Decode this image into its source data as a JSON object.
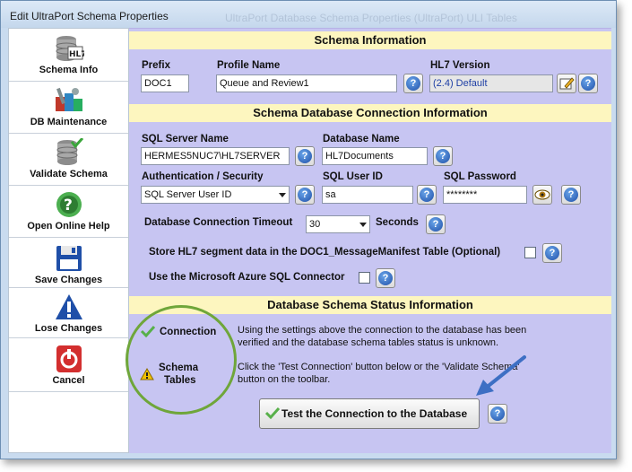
{
  "window": {
    "title": "Edit UltraPort Schema Properties",
    "ghost_title": "UltraPort Database Schema Properties (UltraPort) ULI Tables"
  },
  "toolbar": {
    "items": [
      {
        "label": "Schema Info",
        "icon": "database-hl7-icon"
      },
      {
        "label": "DB Maintenance",
        "icon": "tools-maintenance-icon"
      },
      {
        "label": "Validate Schema",
        "icon": "validate-database-icon"
      },
      {
        "label": "Open Online Help",
        "icon": "help-globe-icon"
      },
      {
        "label": "Save Changes",
        "icon": "floppy-disk-icon"
      },
      {
        "label": "Lose Changes",
        "icon": "warning-triangle-icon"
      },
      {
        "label": "Cancel",
        "icon": "power-cancel-icon"
      }
    ]
  },
  "schema_info": {
    "header": "Schema Information",
    "prefix_label": "Prefix",
    "prefix_value": "DOC1",
    "profile_label": "Profile Name",
    "profile_value": "Queue and Review1",
    "hl7_label": "HL7 Version",
    "hl7_value": "(2.4) Default"
  },
  "connection": {
    "header": "Schema Database Connection Information",
    "server_label": "SQL Server Name",
    "server_value": "HERMES5NUC7\\HL7SERVER",
    "db_label": "Database Name",
    "db_value": "HL7Documents",
    "auth_label": "Authentication / Security",
    "auth_value": "SQL Server User ID",
    "user_label": "SQL User ID",
    "user_value": "sa",
    "pwd_label": "SQL Password",
    "pwd_value": "********",
    "timeout_label": "Database Connection Timeout",
    "timeout_value": "30",
    "timeout_unit": "Seconds",
    "store_label": "Store HL7 segment data in the DOC1_MessageManifest Table (Optional)",
    "azure_label": "Use the Microsoft Azure SQL Connector"
  },
  "status": {
    "header": "Database Schema Status Information",
    "connection_label": "Connection",
    "tables_label_1": "Schema",
    "tables_label_2": "Tables",
    "msg1_line1": "Using the settings above the connection to the database has been",
    "msg1_line2": "verified and the database schema tables status is unknown.",
    "msg2_line1": "Click the 'Test Connection' button below or the 'Validate Schema'",
    "msg2_line2": "button on the toolbar.",
    "test_button": "Test the Connection to the Database"
  },
  "colors": {
    "panel": "#c7c5f2",
    "header": "#fdf6bf",
    "accent_green": "#6fa63a",
    "arrow_blue": "#3d6fc4"
  }
}
